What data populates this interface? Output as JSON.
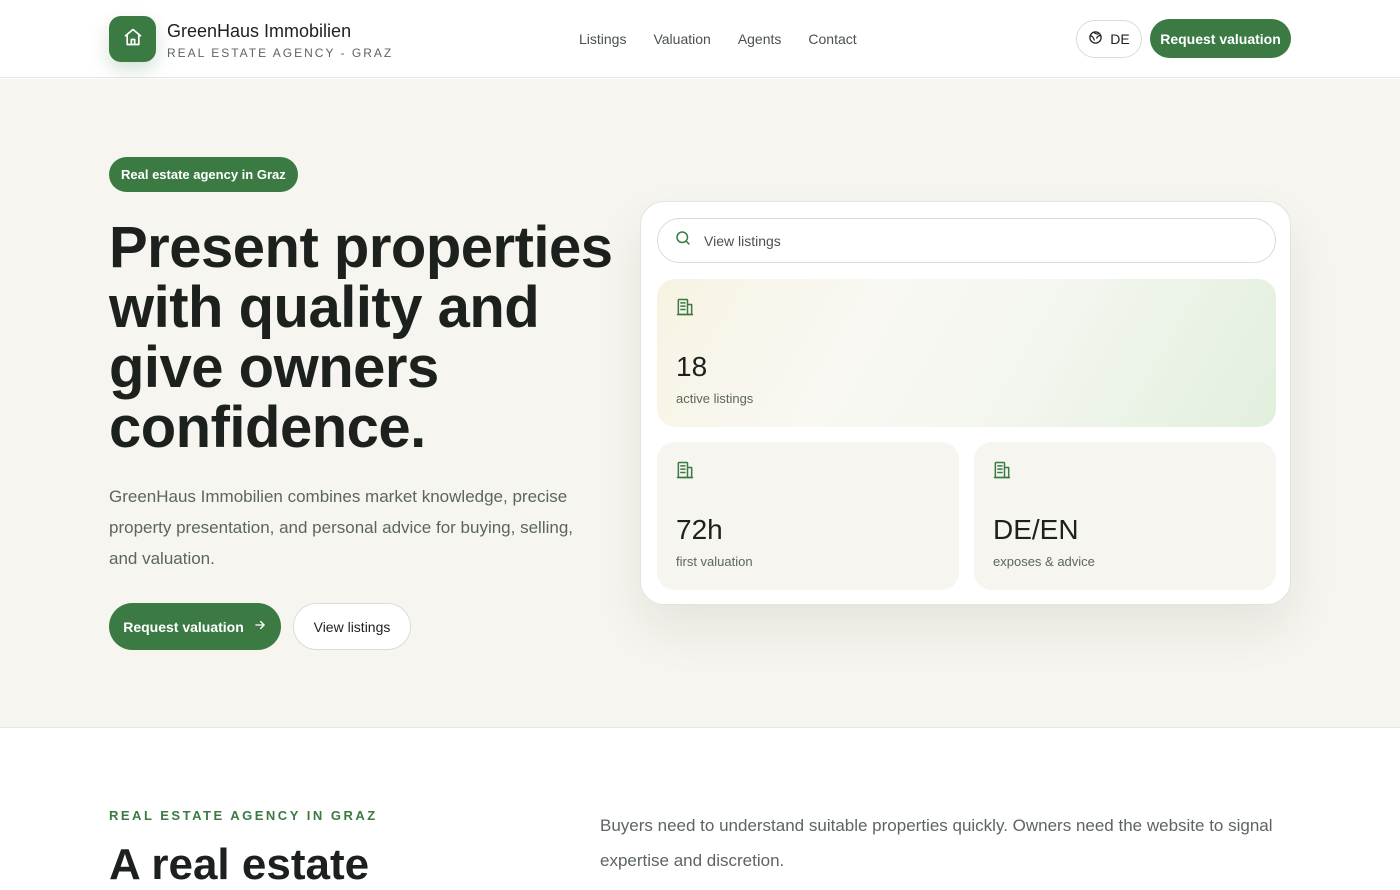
{
  "header": {
    "brand_name": "GreenHaus Immobilien",
    "brand_sub": "REAL ESTATE AGENCY - GRAZ",
    "logo_icon": "home-icon",
    "nav": [
      {
        "label": "Listings"
      },
      {
        "label": "Valuation"
      },
      {
        "label": "Agents"
      },
      {
        "label": "Contact"
      }
    ],
    "language": "DE",
    "language_icon": "globe-icon",
    "cta": "Request valuation"
  },
  "hero": {
    "badge": "Real estate agency in Graz",
    "headline": "Present properties with quality and give owners confidence.",
    "lead": "GreenHaus Immobilien combines market knowledge, precise property presentation, and personal advice for buying, selling, and valuation.",
    "primary_button": "Request valuation",
    "primary_button_icon": "arrow-right-icon",
    "secondary_button": "View listings"
  },
  "stats_card": {
    "search_placeholder": "View listings",
    "search_icon": "search-icon",
    "tiles": [
      {
        "icon": "building-icon",
        "value": "18",
        "label": "active listings"
      },
      {
        "icon": "building-icon",
        "value": "72h",
        "label": "first valuation"
      },
      {
        "icon": "building-icon",
        "value": "DE/EN",
        "label": "exposes & advice"
      }
    ]
  },
  "intro": {
    "eyebrow": "REAL ESTATE AGENCY IN GRAZ",
    "title": "A real estate",
    "text": "Buyers need to understand suitable properties quickly. Owners need the website to signal expertise and discretion."
  },
  "colors": {
    "accent": "#3b7a43",
    "hero_background": "#f6f5ef",
    "text": "#1c211d",
    "muted_text": "#5d655f"
  }
}
